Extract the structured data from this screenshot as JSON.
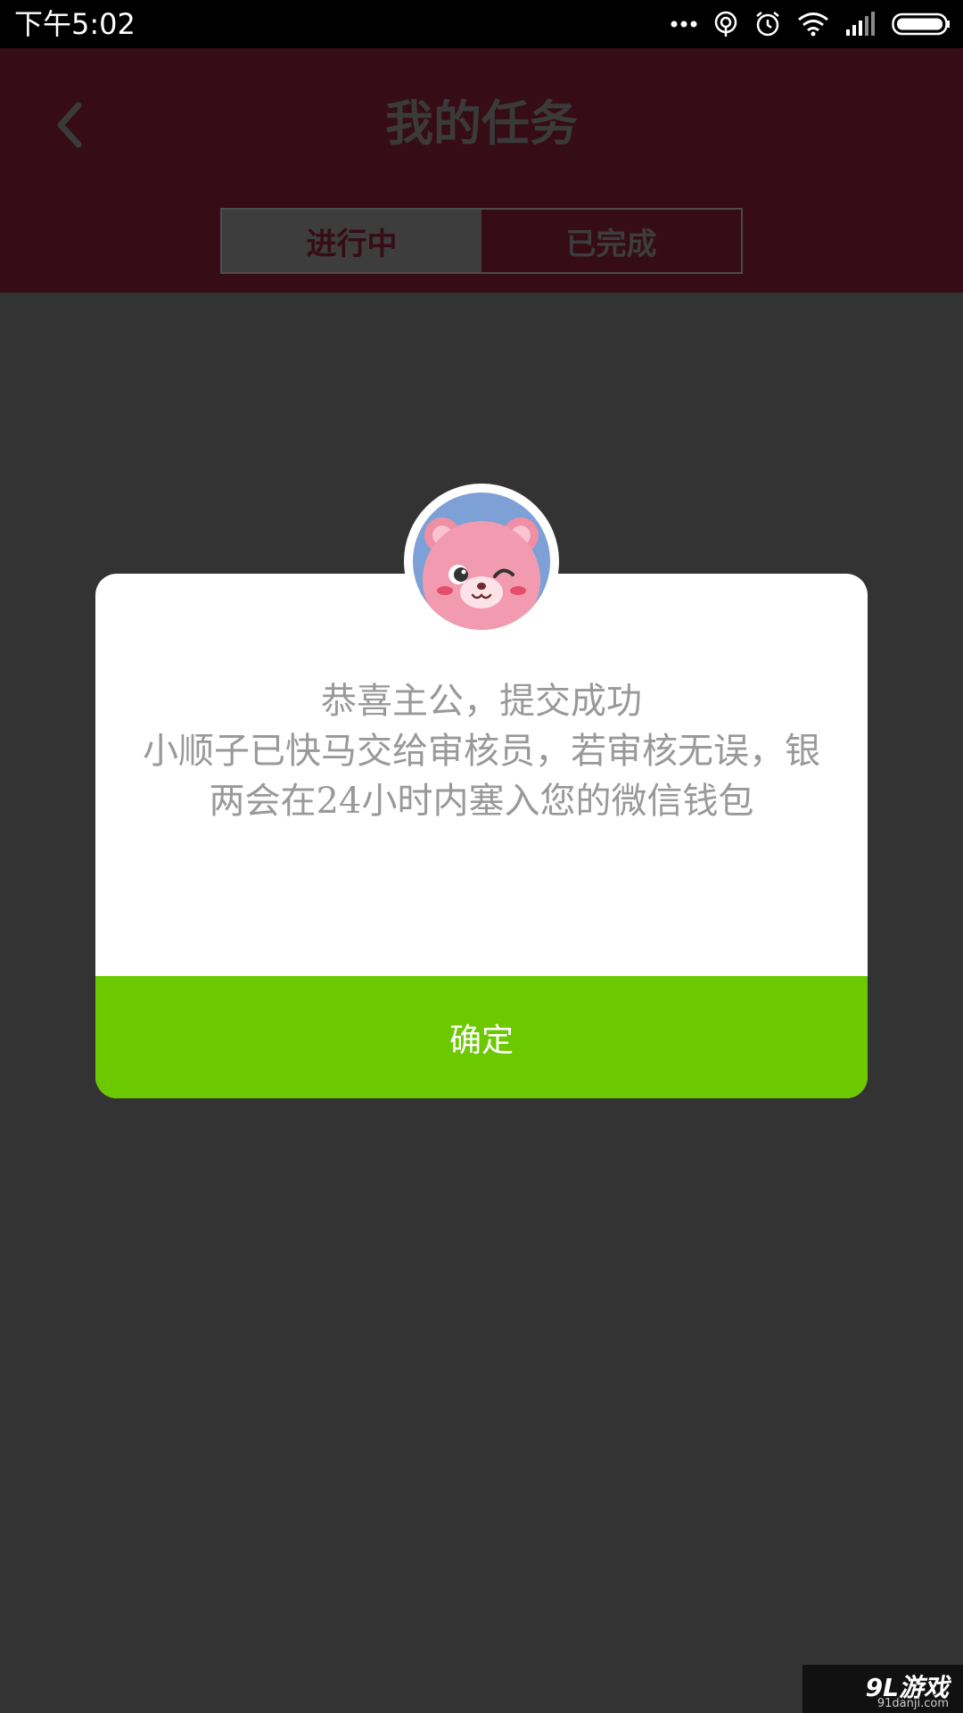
{
  "status_bar": {
    "time": "下午5:02",
    "icons": [
      "more-dots-icon",
      "hotspot-icon",
      "alarm-icon",
      "wifi-icon",
      "signal-icon",
      "battery-icon"
    ]
  },
  "header": {
    "title": "我的任务",
    "back_icon": "chevron-left-icon",
    "background_color": "#360c17"
  },
  "tabs": [
    {
      "label": "进行中",
      "selected": true
    },
    {
      "label": "已完成",
      "selected": false
    }
  ],
  "dialog": {
    "message_lines": [
      "恭喜主公，提交成功",
      "小顺子已快马交给审核员，若审核无误，银两会在24小时内塞入您的微信钱包"
    ],
    "confirm_label": "确定",
    "confirm_color": "#6cc900",
    "avatar_icon": "pink-bear-winking-icon"
  },
  "watermark": {
    "logo": "9L游戏",
    "site": "91danji.com"
  }
}
